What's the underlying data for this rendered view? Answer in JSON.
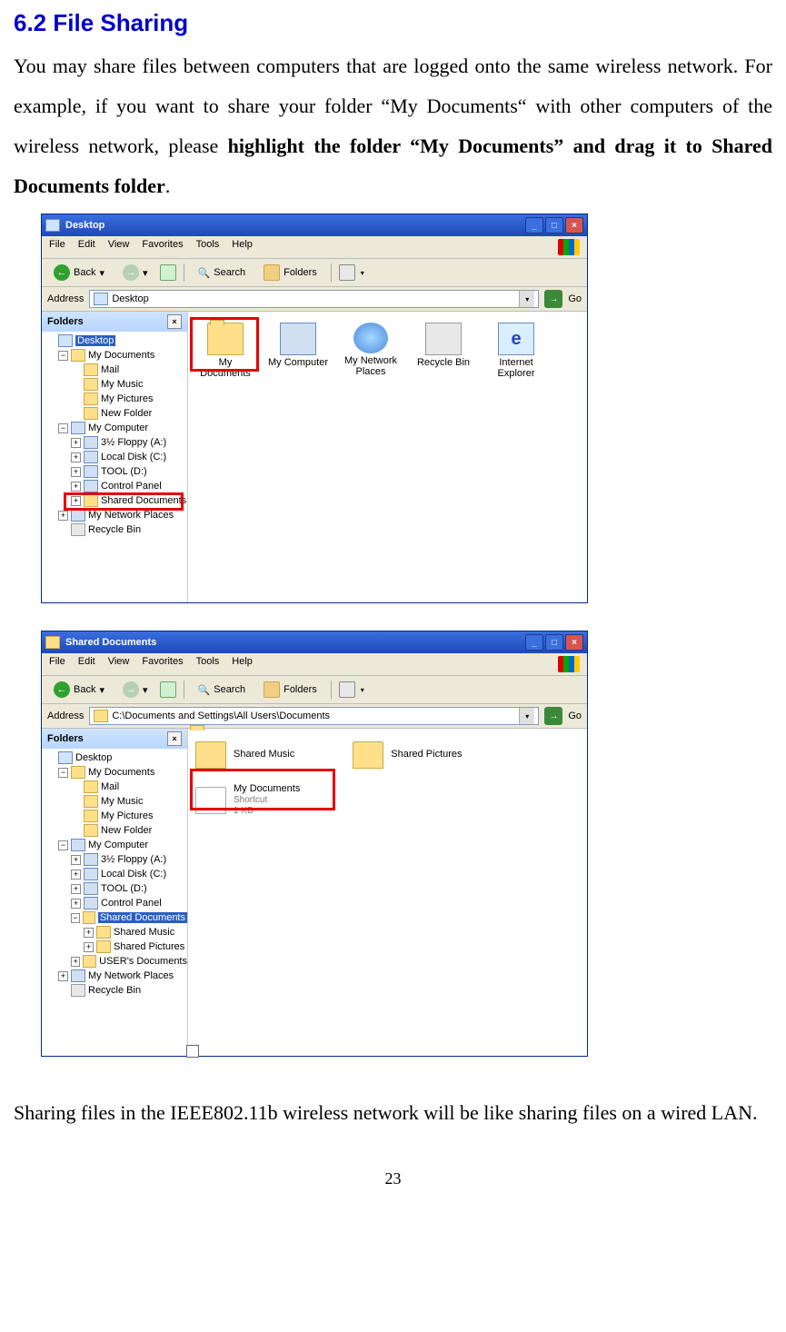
{
  "heading": "6.2 File Sharing",
  "para1_a": "You may share files between computers that are logged onto the same wireless network. For example, if you want to share your folder “My Documents“ with other computers of the wireless network, please ",
  "para1_b": "highlight the folder “My Documents” and drag it to Shared Documents folder",
  "para1_c": ".",
  "para2": "Sharing files in the IEEE802.11b wireless network will be like sharing files on a wired LAN.",
  "page_number": "23",
  "win1": {
    "title": "Desktop",
    "menus": [
      "File",
      "Edit",
      "View",
      "Favorites",
      "Tools",
      "Help"
    ],
    "back": "Back",
    "search": "Search",
    "folders": "Folders",
    "addr_label": "Address",
    "addr_value": "Desktop",
    "go": "Go",
    "pane_header": "Folders",
    "tree": {
      "desktop": "Desktop",
      "mydocs": "My Documents",
      "mail": "Mail",
      "mymusic": "My Music",
      "mypics": "My Pictures",
      "newfolder": "New Folder",
      "mycomp": "My Computer",
      "floppy": "3½ Floppy (A:)",
      "localc": "Local Disk (C:)",
      "toold": "TOOL (D:)",
      "ctrlpanel": "Control Panel",
      "shared": "Shared Documents",
      "netplaces": "My Network Places",
      "recycle": "Recycle Bin"
    },
    "icons": {
      "mydocs": "My Documents",
      "mycomp": "My Computer",
      "netplaces": "My Network Places",
      "recycle": "Recycle Bin",
      "ie": "Internet Explorer"
    }
  },
  "win2": {
    "title": "Shared Documents",
    "menus": [
      "File",
      "Edit",
      "View",
      "Favorites",
      "Tools",
      "Help"
    ],
    "back": "Back",
    "search": "Search",
    "folders": "Folders",
    "addr_label": "Address",
    "addr_value": "C:\\Documents and Settings\\All Users\\Documents",
    "go": "Go",
    "pane_header": "Folders",
    "tree": {
      "desktop": "Desktop",
      "mydocs": "My Documents",
      "mail": "Mail",
      "mymusic": "My Music",
      "mypics": "My Pictures",
      "newfolder": "New Folder",
      "mycomp": "My Computer",
      "floppy": "3½ Floppy (A:)",
      "localc": "Local Disk (C:)",
      "toold": "TOOL (D:)",
      "ctrlpanel": "Control Panel",
      "shared": "Shared Documents",
      "sharedmusic": "Shared Music",
      "sharedpics": "Shared Pictures",
      "userdocs": "USER's Documents",
      "netplaces": "My Network Places",
      "recycle": "Recycle Bin"
    },
    "items": {
      "sharedmusic": "Shared Music",
      "sharedpics": "Shared Pictures",
      "shortcut_name": "My Documents",
      "shortcut_type": "Shortcut",
      "shortcut_size": "1 KB"
    }
  }
}
